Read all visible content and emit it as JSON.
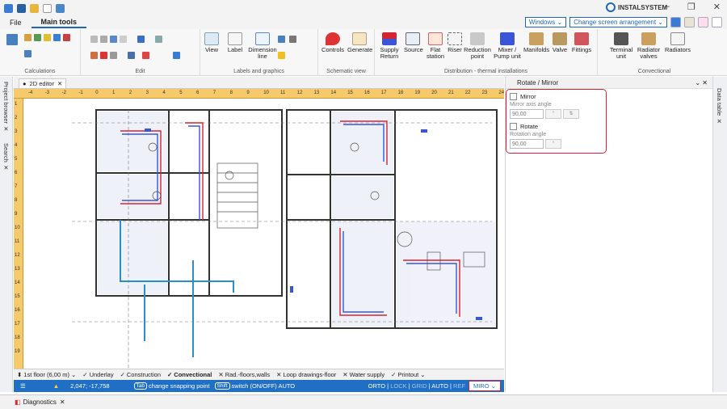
{
  "app": {
    "brand": "INSTALSYSTEM"
  },
  "menu": {
    "file": "File",
    "main_tools": "Main tools",
    "windows": "Windows",
    "screen_arrangement": "Change screen arrangement"
  },
  "ribbon": {
    "groups": [
      {
        "id": "calculations",
        "label": "Calculations"
      },
      {
        "id": "edit",
        "label": "Edit"
      },
      {
        "id": "labels",
        "label": "Labels and graphics"
      },
      {
        "id": "schematic",
        "label": "Schematic view"
      },
      {
        "id": "distribution",
        "label": "Distribution - thermal installations"
      },
      {
        "id": "convectional",
        "label": "Convectional"
      }
    ],
    "buttons": {
      "view": "View",
      "label": "Label",
      "dimension": "Dimension line",
      "controls": "Controls",
      "generate": "Generate",
      "supply_return": "Supply Return",
      "source": "Source",
      "flat_station": "Flat station",
      "riser": "Riser",
      "reduction_point": "Reduction point",
      "mixer_pump": "Mixer / Pump unit",
      "manifolds": "Manifolds",
      "valve": "Valve",
      "fittings": "Fittings",
      "terminal_unit": "Terminal unit",
      "radiator_valves": "Radiator valves",
      "radiators": "Radiators"
    }
  },
  "left_rail": {
    "project_browser": "Project browser",
    "search": "Search"
  },
  "editor_tab": {
    "label": "2D editor"
  },
  "ruler": {
    "h_ticks": [
      "-4",
      "-3",
      "-2",
      "-1",
      "0",
      "1",
      "2",
      "3",
      "4",
      "5",
      "6",
      "7",
      "8",
      "9",
      "10",
      "11",
      "12",
      "13",
      "14",
      "15",
      "16",
      "17",
      "18",
      "19",
      "20",
      "21",
      "22",
      "23",
      "24"
    ],
    "v_ticks": [
      "1",
      "2",
      "3",
      "4",
      "5",
      "6",
      "7",
      "8",
      "9",
      "10",
      "11",
      "12",
      "13",
      "14",
      "15",
      "16",
      "17",
      "18",
      "19"
    ]
  },
  "layer_bar": {
    "floor": "1st floor (6,00 m)",
    "layers": [
      "Underlay",
      "Construction",
      "Convectional",
      "Rad.-floors,walls",
      "Loop drawings-floor",
      "Water supply",
      "Printout"
    ],
    "active": "Convectional"
  },
  "status_bar": {
    "coords": "2,047; -17,758",
    "tab_hint": "change snapping point",
    "shift_hint": "switch (ON/OFF) AUTO",
    "modes": [
      "ORTO",
      "LOCK",
      "GRID",
      "AUTO",
      "REF"
    ],
    "miro": "MIRO",
    "tab_key": "Tab",
    "shift_key": "Shift"
  },
  "panel": {
    "title": "Rotate / Mirror",
    "mirror_label": "Mirror",
    "mirror_axis_label": "Mirror axis angle",
    "mirror_value": "90,00",
    "rotate_label": "Rotate",
    "rotation_label": "Rotation angle",
    "rotate_value": "90,00",
    "unit": "°"
  },
  "right_rail": {
    "data_table": "Data table"
  },
  "diagnostics": {
    "label": "Diagnostics"
  },
  "colors": {
    "accent": "#1f6fc4",
    "highlight": "#d62332",
    "ruler": "#f6c96a",
    "pipe_supply": "#d62332",
    "pipe_return": "#3a55d8",
    "pipe_water": "#2a8fc7"
  }
}
